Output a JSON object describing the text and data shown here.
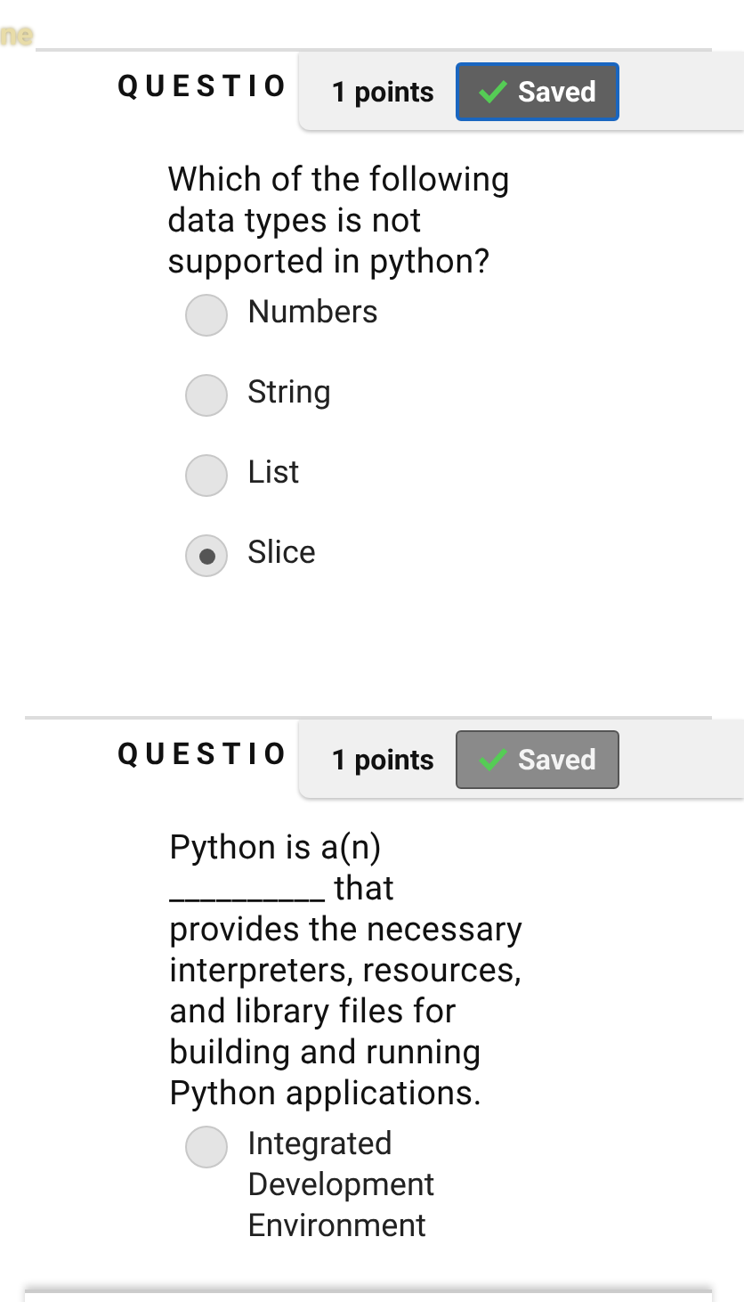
{
  "top_fragment": "ne",
  "questions": [
    {
      "label": "QUESTIO",
      "points": "1 points",
      "saved": {
        "label": "Saved",
        "focused": true
      },
      "text": "Which of the following data types is not supported in python?",
      "options": [
        {
          "label": "Numbers",
          "selected": false
        },
        {
          "label": "String",
          "selected": false
        },
        {
          "label": "List",
          "selected": false
        },
        {
          "label": "Slice",
          "selected": true
        }
      ]
    },
    {
      "label": "QUESTIO",
      "points": "1 points",
      "saved": {
        "label": "Saved",
        "focused": false
      },
      "text": "Python is a(n) __________ that provides the necessary interpreters, resources, and library files for building and running Python applications.",
      "options": [
        {
          "label": "Integrated Development Environment",
          "selected": false
        }
      ]
    }
  ]
}
